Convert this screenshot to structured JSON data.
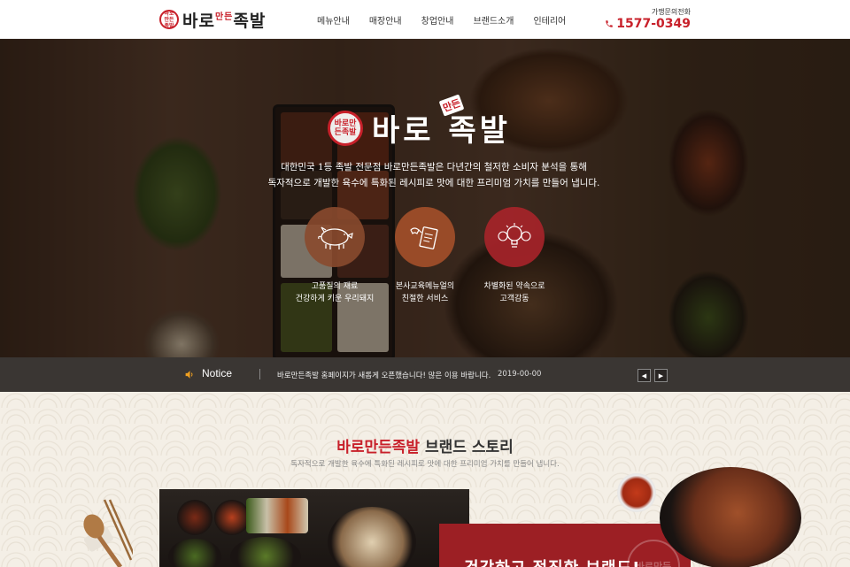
{
  "header": {
    "logo_seal": "바로만든족발",
    "logo_text": "바로",
    "logo_text2": "족발",
    "logo_mark": "만든",
    "nav": [
      "메뉴안내",
      "매장안내",
      "창업안내",
      "브랜드소개",
      "인테리어"
    ],
    "contact_label": "가맹문의전화",
    "contact_number": "1577-0349"
  },
  "hero": {
    "seal": "바로만든족발",
    "title_left": "바로",
    "title_right": "족발",
    "title_mark": "만든",
    "desc_line1": "대한민국 1등 족발 전문점 바로만든족발은 다년간의 철저한 소비자 분석을 통해",
    "desc_line2": "독자적으로 개발한 육수에 특화된 레시피로 맛에 대한 프리미엄 가치를 만들어 냅니다.",
    "features": [
      {
        "line1": "고품질의 재료",
        "line2": "건강하게 키운 우리돼지",
        "color": "#8a4a2e"
      },
      {
        "line1": "본사교육메뉴얼의",
        "line2": "친절한 서비스",
        "color": "#a4502a"
      },
      {
        "line1": "차별화된 약속으로",
        "line2": "고객감동",
        "color": "#a8242a"
      }
    ]
  },
  "notice": {
    "title": "Notice",
    "text": "바로만든족발 홈페이지가 새롭게 오픈했습니다! 많은 이용 바랍니다.",
    "date": "2019-00-00",
    "prev": "◀",
    "next": "▶"
  },
  "story": {
    "title_accent": "바로만든족발",
    "title_rest": " 브랜드 스토리",
    "desc": "독자적으로 개발한 육수에 특화된 레시피로 맛에 대한 프리미엄 가치를 만들어 냅니다.",
    "card_text": "건강하고 정직한 브랜드!",
    "card_seal": "바로만든"
  }
}
